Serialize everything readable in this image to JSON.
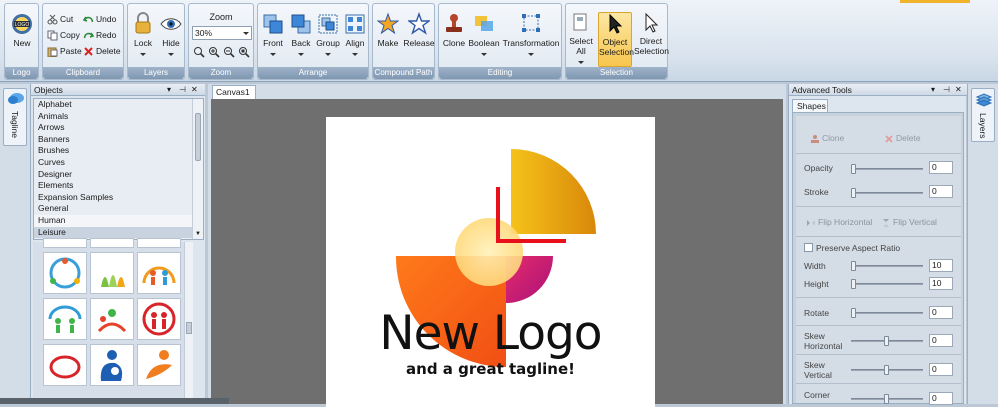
{
  "ribbon": {
    "groups": {
      "logo": "Logo",
      "clipboard": "Clipboard",
      "layers": "Layers",
      "zoom": "Zoom",
      "arrange": "Arrange",
      "compound": "Compound Path",
      "editing": "Editing",
      "selection": "Selection"
    },
    "buttons": {
      "new": "New",
      "cut": "Cut",
      "copy": "Copy",
      "paste": "Paste",
      "undo": "Undo",
      "redo": "Redo",
      "delete": "Delete",
      "lock": "Lock",
      "hide": "Hide",
      "zoom_title": "Zoom",
      "zoom_value": "30%",
      "front": "Front",
      "back": "Back",
      "group": "Group",
      "align": "Align",
      "make": "Make",
      "release": "Release",
      "clone": "Clone",
      "boolean": "Boolean",
      "transformation": "Transformation",
      "select_all_1": "Select",
      "select_all_2": "All",
      "object_sel_1": "Object",
      "object_sel_2": "Selection",
      "direct_sel_1": "Direct",
      "direct_sel_2": "Selection"
    }
  },
  "left_tab": "Tagline",
  "objects_panel": {
    "title": "Objects",
    "items": [
      "Alphabet",
      "Animals",
      "Arrows",
      "Banners",
      "Brushes",
      "Curves",
      "Designer",
      "Elements",
      "Expansion Samples",
      "General",
      "Human",
      "Leisure"
    ],
    "selected": "Leisure"
  },
  "canvas_tab": "Canvas1",
  "logo": {
    "title": "New Logo",
    "tagline": "and a great tagline!"
  },
  "tools_panel": {
    "title": "Advanced Tools",
    "tab": "Shapes",
    "clone": "Clone",
    "delete": "Delete",
    "opacity_label": "Opacity",
    "opacity_value": "0",
    "stroke_label": "Stroke",
    "stroke_value": "0",
    "flip_h": "Flip Horizontal",
    "flip_v": "Flip Vertical",
    "preserve": "Preserve Aspect Ratio",
    "width_label": "Width",
    "width_value": "10",
    "height_label": "Height",
    "height_value": "10",
    "rotate_label": "Rotate",
    "rotate_value": "0",
    "skewh_label_1": "Skew",
    "skewh_label_2": "Horizontal",
    "skewh_value": "0",
    "skewv_label_1": "Skew",
    "skewv_label_2": "Vertical",
    "skewv_value": "0",
    "corner_label": "Corner",
    "corner_value": "0"
  },
  "right_tab": "Layers"
}
